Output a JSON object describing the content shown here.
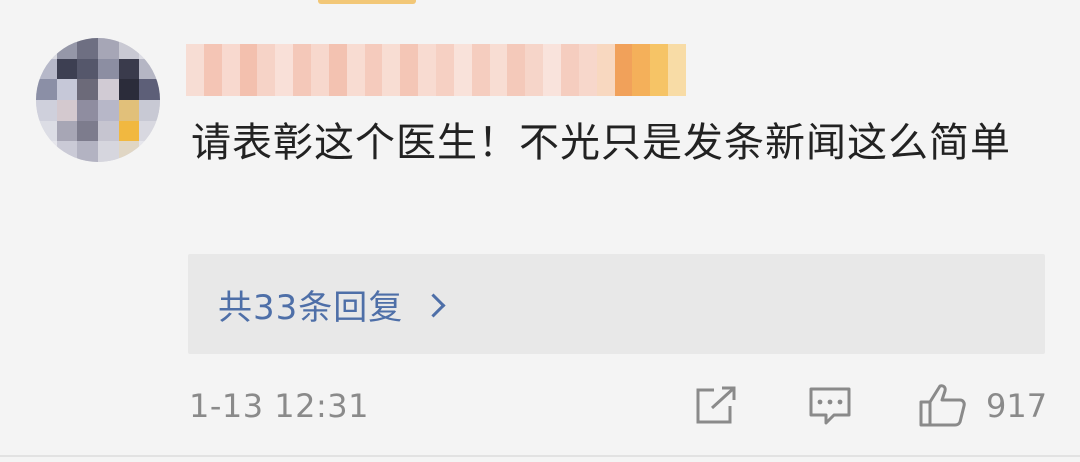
{
  "comment": {
    "text": "请表彰这个医生！不光只是发条新闻这么简单",
    "replies_label": "共33条回复",
    "timestamp": "1-13 12:31",
    "like_count": "917"
  },
  "icons": {
    "share": "share-icon",
    "comment": "comment-icon",
    "like": "thumbs-up-icon",
    "chevron": "chevron-right-icon"
  },
  "colors": {
    "background": "#f4f4f4",
    "link": "#4e6fa8",
    "text": "#222222",
    "meta": "#8a8a8a",
    "reply_box": "#e8e8e8"
  }
}
